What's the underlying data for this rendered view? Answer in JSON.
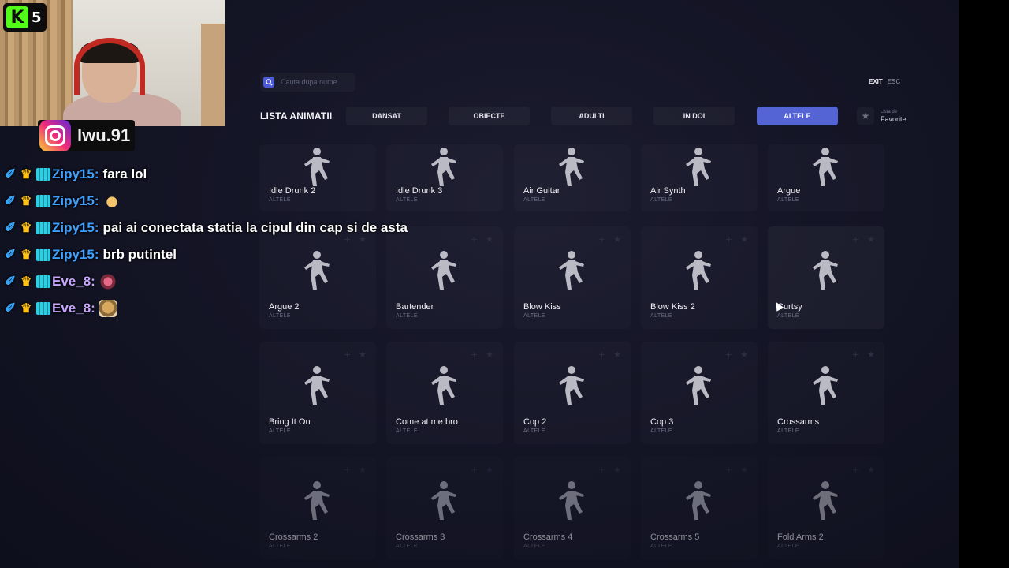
{
  "stream": {
    "platform_badge": "K",
    "viewer_count": "5",
    "instagram_handle": "lwu.91"
  },
  "chat": [
    {
      "user": "Zipy15",
      "message": "fara lol",
      "color": "#3ea0ff",
      "emote": ""
    },
    {
      "user": "Zipy15",
      "message": "",
      "color": "#3ea0ff",
      "emote": "hand-emote"
    },
    {
      "user": "Zipy15",
      "message": "pai ai conectata statia la cipul din cap si de asta",
      "color": "#3ea0ff",
      "emote": ""
    },
    {
      "user": "Zipy15",
      "message": "brb putintel",
      "color": "#3ea0ff",
      "emote": ""
    },
    {
      "user": "Eve_8",
      "message": "",
      "color": "#c8a6ff",
      "emote": "pink-emote"
    },
    {
      "user": "Eve_8",
      "message": "",
      "color": "#c8a6ff",
      "emote": "dog-emote"
    }
  ],
  "ui": {
    "search_placeholder": "Cauta dupa nume",
    "exit_label": "EXIT",
    "esc_label": "ESC",
    "list_title": "LISTA ANIMATII",
    "tabs": [
      "DANSAT",
      "OBIECTE",
      "ADULTI",
      "IN DOI",
      "ALTELE"
    ],
    "active_tab": "ALTELE",
    "favorites_small": "Lista de",
    "favorites_label": "Favorite",
    "accent_color": "#5564d4"
  },
  "animations": [
    {
      "name": "Idle Drunk 2",
      "category": "ALTELE"
    },
    {
      "name": "Idle Drunk 3",
      "category": "ALTELE"
    },
    {
      "name": "Air Guitar",
      "category": "ALTELE"
    },
    {
      "name": "Air Synth",
      "category": "ALTELE"
    },
    {
      "name": "Argue",
      "category": "ALTELE"
    },
    {
      "name": "Argue 2",
      "category": "ALTELE"
    },
    {
      "name": "Bartender",
      "category": "ALTELE"
    },
    {
      "name": "Blow Kiss",
      "category": "ALTELE"
    },
    {
      "name": "Blow Kiss 2",
      "category": "ALTELE"
    },
    {
      "name": "Curtsy",
      "category": "ALTELE"
    },
    {
      "name": "Bring It On",
      "category": "ALTELE"
    },
    {
      "name": "Come at me bro",
      "category": "ALTELE"
    },
    {
      "name": "Cop 2",
      "category": "ALTELE"
    },
    {
      "name": "Cop 3",
      "category": "ALTELE"
    },
    {
      "name": "Crossarms",
      "category": "ALTELE"
    },
    {
      "name": "Crossarms 2",
      "category": "ALTELE"
    },
    {
      "name": "Crossarms 3",
      "category": "ALTELE"
    },
    {
      "name": "Crossarms 4",
      "category": "ALTELE"
    },
    {
      "name": "Crossarms 5",
      "category": "ALTELE"
    },
    {
      "name": "Fold Arms 2",
      "category": "ALTELE"
    }
  ]
}
